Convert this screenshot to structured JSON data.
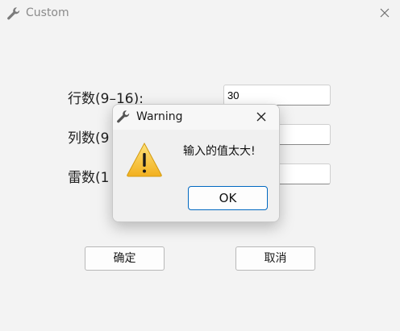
{
  "window": {
    "title": "Custom",
    "icon": "wrench-icon"
  },
  "form": {
    "rows_label": "行数(9–16):",
    "rows_value": "30",
    "cols_label": "列数(9",
    "cols_value": "",
    "mines_label": "雷数(1",
    "mines_value": ""
  },
  "buttons": {
    "confirm_label": "确定",
    "cancel_label": "取消"
  },
  "dialog": {
    "title": "Warning",
    "icon": "wrench-icon",
    "message": "输入的值太大!",
    "ok_label": "OK",
    "warning_icon": "warning-triangle-icon",
    "accent_color": "#0067c0",
    "warning_color": "#f7c62f"
  }
}
